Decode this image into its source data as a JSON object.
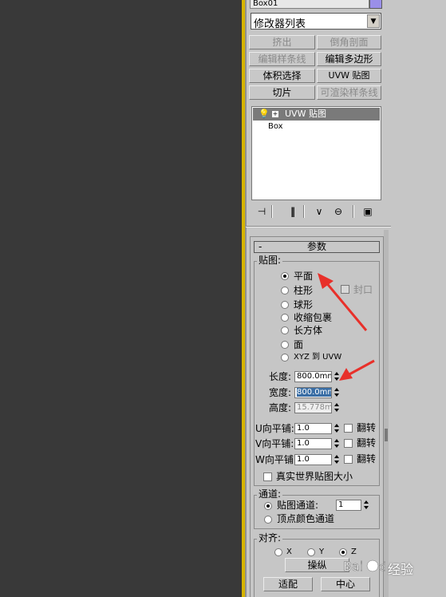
{
  "object": {
    "name": "Box01",
    "color": "#9a8fe8"
  },
  "modifier_list": {
    "label": "修改器列表"
  },
  "modifier_buttons": [
    {
      "label": "挤出",
      "enabled": false
    },
    {
      "label": "倒角剖面",
      "enabled": false
    },
    {
      "label": "编辑样条线",
      "enabled": false
    },
    {
      "label": "编辑多边形",
      "enabled": true
    },
    {
      "label": "体积选择",
      "enabled": true
    },
    {
      "label": "UVW 贴图",
      "enabled": true
    },
    {
      "label": "切片",
      "enabled": true
    },
    {
      "label": "可渲染样条线",
      "enabled": false
    }
  ],
  "stack": {
    "selected": "UVW 贴图",
    "base": "Box"
  },
  "parameters": {
    "title": "参数",
    "collapse": "-",
    "mapping": {
      "title": "贴图:",
      "options": [
        {
          "label": "平面",
          "selected": true
        },
        {
          "label": "柱形",
          "selected": false
        },
        {
          "label": "球形",
          "selected": false
        },
        {
          "label": "收缩包裹",
          "selected": false
        },
        {
          "label": "长方体",
          "selected": false
        },
        {
          "label": "面",
          "selected": false
        },
        {
          "label": "XYZ 到 UVW",
          "selected": false
        }
      ],
      "cap_label": "封口"
    },
    "length": {
      "label": "长度:",
      "value": "800.0mm"
    },
    "width": {
      "label": "宽度:",
      "value": "800.0mm"
    },
    "height": {
      "label": "高度:",
      "value": "15.778m"
    },
    "tiles": [
      {
        "label": "U向平铺:",
        "value": "1.0",
        "flip": "翻转"
      },
      {
        "label": "V向平铺:",
        "value": "1.0",
        "flip": "翻转"
      },
      {
        "label": "W向平铺:",
        "value": "1.0",
        "flip": "翻转"
      }
    ],
    "real_world": "真实世界贴图大小",
    "channel": {
      "title": "通道:",
      "map_channel": "贴图通道:",
      "map_channel_value": "1",
      "vertex_color": "顶点颜色通道"
    },
    "alignment": {
      "title": "对齐:",
      "axes": [
        {
          "label": "X",
          "selected": false
        },
        {
          "label": "Y",
          "selected": false
        },
        {
          "label": "Z",
          "selected": true
        }
      ],
      "manipulate": "操纵",
      "fit": "适配",
      "center": "中心"
    }
  },
  "watermark": "经验"
}
